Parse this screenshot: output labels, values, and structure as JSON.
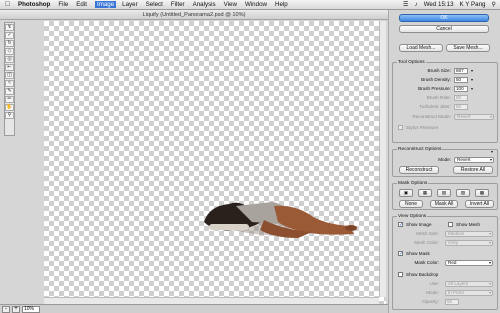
{
  "menubar": {
    "app": "Photoshop",
    "items": [
      "File",
      "Edit",
      "Image",
      "Layer",
      "Select",
      "Filter",
      "Analysis",
      "View",
      "Window",
      "Help"
    ],
    "highlighted": "Image",
    "time": "Wed 15:13",
    "user": "K Y Pang"
  },
  "window": {
    "title": "Liquify (Untitled_Panorama2.psd @ 10%)"
  },
  "status": {
    "zoom": "10%",
    "minus": "-",
    "plus": "+"
  },
  "buttons": {
    "ok": "OK",
    "cancel": "Cancel",
    "load_mesh": "Load Mesh...",
    "save_mesh": "Save Mesh..."
  },
  "tool_options": {
    "title": "Tool Options",
    "brush_size_label": "Brush Size:",
    "brush_size": "687",
    "brush_density_label": "Brush Density:",
    "brush_density": "50",
    "brush_pressure_label": "Brush Pressure:",
    "brush_pressure": "100",
    "brush_rate_label": "Brush Rate:",
    "brush_rate": "80",
    "turbulent_jitter_label": "Turbulent Jitter:",
    "turbulent_jitter": "50",
    "reconstruct_mode_label": "Reconstruct Mode:",
    "reconstruct_mode": "Revert",
    "stylus_pressure_label": "Stylus Pressure"
  },
  "reconstruct_options": {
    "title": "Reconstruct Options",
    "mode_label": "Mode:",
    "mode": "Revert",
    "reconstruct_button": "Reconstruct",
    "restore_all_button": "Restore All"
  },
  "mask_options": {
    "title": "Mask Options",
    "none_button": "None",
    "mask_all_button": "Mask All",
    "invert_all_button": "Invert All"
  },
  "view_options": {
    "title": "View Options",
    "show_image_label": "Show Image",
    "show_image_checked": true,
    "show_mesh_label": "Show Mesh",
    "show_mesh_checked": false,
    "mesh_size_label": "Mesh Size:",
    "mesh_size": "Medium",
    "mesh_color_label": "Mesh Color:",
    "mesh_color": "Grey",
    "show_mask_label": "Show Mask",
    "show_mask_checked": true,
    "mask_color_label": "Mask Color:",
    "mask_color": "Red",
    "show_backdrop_label": "Show Backdrop",
    "show_backdrop_checked": false,
    "use_label": "Use:",
    "use": "All Layers",
    "mode_label": "Mode:",
    "mode": "In Front",
    "opacity_label": "Opacity:",
    "opacity": "50"
  },
  "icons": [
    "apple-icon",
    "warp-tool-icon",
    "reconstruct-tool-icon",
    "twirl-tool-icon",
    "pucker-tool-icon",
    "bloat-tool-icon",
    "push-left-tool-icon",
    "mirror-tool-icon",
    "turbulence-tool-icon",
    "freeze-mask-tool-icon",
    "thaw-mask-tool-icon",
    "hand-tool-icon",
    "zoom-tool-icon",
    "wifi-icon",
    "volume-icon",
    "spotlight-icon",
    "chevron-down-icon"
  ],
  "colors": {
    "selection_blue": "#3875d7",
    "ok_blue": "#3d86e0",
    "checker_grey": "#cfcfcf",
    "panel_bg": "#d4d4d4"
  }
}
